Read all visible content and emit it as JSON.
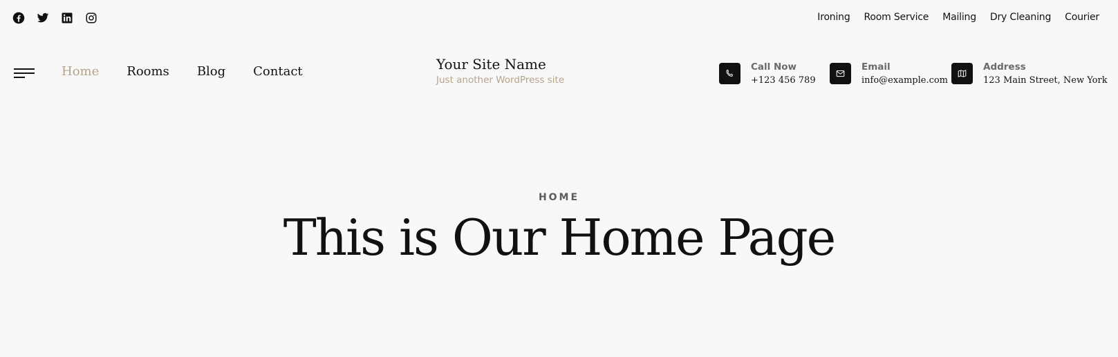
{
  "social": [
    {
      "name": "facebook-icon"
    },
    {
      "name": "twitter-icon"
    },
    {
      "name": "linkedin-icon"
    },
    {
      "name": "instagram-icon"
    }
  ],
  "services": [
    "Ironing",
    "Room Service",
    "Mailing",
    "Dry Cleaning",
    "Courier"
  ],
  "menu": {
    "icon": "hamburger-menu-icon"
  },
  "nav": {
    "items": [
      "Home",
      "Rooms",
      "Blog",
      "Contact"
    ],
    "active": "Home"
  },
  "brand": {
    "site_name": "Your Site Name",
    "tagline": "Just another WordPress site"
  },
  "contacts": [
    {
      "icon": "phone-icon",
      "label": "Call Now",
      "value": "+123 456 789"
    },
    {
      "icon": "envelope-icon",
      "label": "Email",
      "value": "info@example.com"
    },
    {
      "icon": "map-icon",
      "label": "Address",
      "value": "123 Main Street, New York"
    }
  ],
  "hero": {
    "eyebrow": "HOME",
    "title": "This is Our Home Page"
  },
  "colors": {
    "background": "#f8f8f8",
    "accent": "#b5a48a",
    "text": "#111111",
    "icon_box": "#111111"
  }
}
